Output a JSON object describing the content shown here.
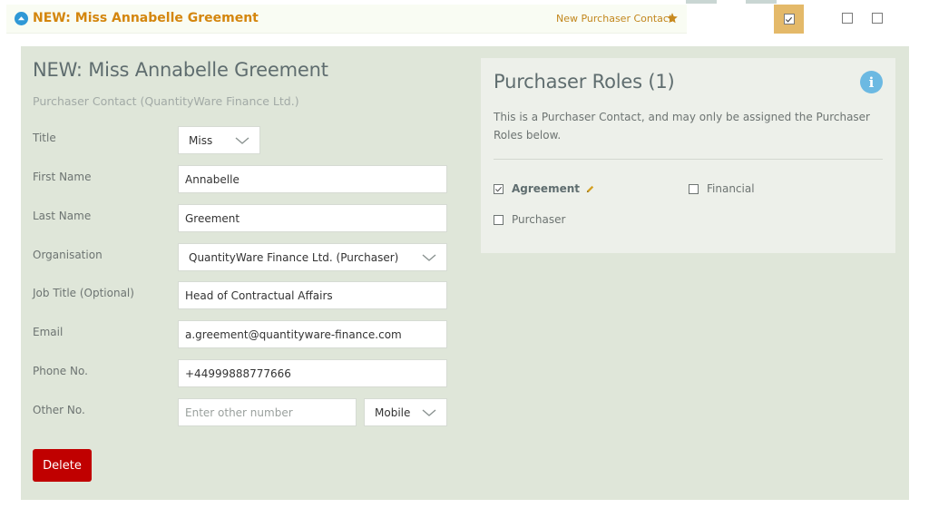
{
  "header": {
    "title": "NEW: Miss Annabelle Greement",
    "contact_type": "New Purchaser Contact"
  },
  "form": {
    "title": "NEW: Miss Annabelle Greement",
    "subtitle": "Purchaser Contact (QuantityWare Finance Ltd.)",
    "fields": {
      "title": {
        "label": "Title",
        "value": "Miss"
      },
      "first_name": {
        "label": "First Name",
        "value": "Annabelle"
      },
      "last_name": {
        "label": "Last Name",
        "value": "Greement"
      },
      "organisation": {
        "label": "Organisation",
        "value": "QuantityWare Finance Ltd. (Purchaser)"
      },
      "job_title": {
        "label": "Job Title (Optional)",
        "value": "Head of Contractual Affairs"
      },
      "email": {
        "label": "Email",
        "value": "a.greement@quantityware-finance.com"
      },
      "phone": {
        "label": "Phone No.",
        "value": "+44999888777666"
      },
      "other": {
        "label": "Other No.",
        "placeholder": "Enter other number",
        "type_value": "Mobile"
      }
    },
    "delete_label": "Delete"
  },
  "roles": {
    "title": "Purchaser Roles (1)",
    "description": "This is a Purchaser Contact, and may only be assigned the Purchaser Roles below.",
    "items": [
      {
        "label": "Agreement",
        "checked": true
      },
      {
        "label": "Financial",
        "checked": false
      },
      {
        "label": "Purchaser",
        "checked": false
      }
    ]
  },
  "colors": {
    "accent": "#d4860e",
    "panel_bg": "#dfe6d9",
    "info": "#6cb9e2",
    "delete": "#c00000"
  },
  "icons": [
    "collapse-up-icon",
    "star-icon",
    "checkbox-icon",
    "info-icon",
    "chevron-down-icon",
    "pencil-icon"
  ]
}
